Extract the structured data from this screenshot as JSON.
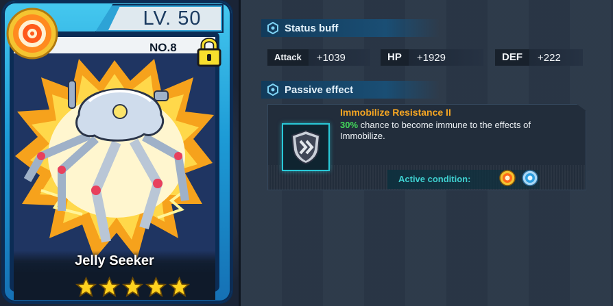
{
  "card": {
    "level": "LV. 50",
    "number": "NO.8",
    "name": "Jelly Seeker",
    "stars": 5,
    "element_icon": "fire-element-icon",
    "lock_icon": "lock-icon"
  },
  "status_buff": {
    "title": "Status buff",
    "stats": [
      {
        "label": "Attack",
        "value": "+1039"
      },
      {
        "label": "HP",
        "value": "+1929"
      },
      {
        "label": "DEF",
        "value": "+222"
      }
    ]
  },
  "passive_effect": {
    "title": "Passive effect",
    "skill_name": "Immobilize Resistance II",
    "chance": "30%",
    "description": " chance to become immune to the effects of Immobilize.",
    "active_condition_label": "Active condition:",
    "condition_icons": [
      "fire-element-icon",
      "water-element-icon"
    ]
  },
  "colors": {
    "skill_name": "#f6a623",
    "highlight": "#43d95a",
    "condition_label": "#3fd0d0",
    "card_frame": "#1d9bd6"
  }
}
